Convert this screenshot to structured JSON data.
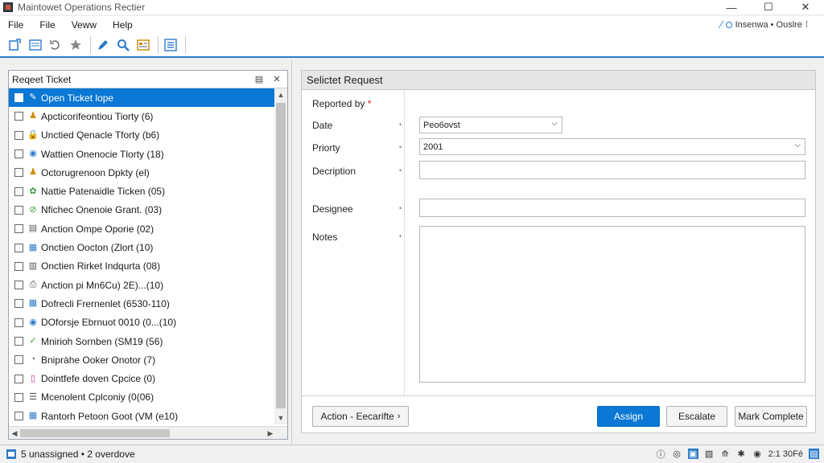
{
  "window": {
    "title": "Maintowet Operations Rectier",
    "minimize": "—",
    "maximize": "☐",
    "close": "✕"
  },
  "menu": {
    "items": [
      "File",
      "File",
      "Veww",
      "Help"
    ],
    "status_text": "Insenwa • Ouslre"
  },
  "left_panel": {
    "title": "Reqeet Ticket",
    "rows": [
      {
        "label": "Open Ticket lope",
        "icon": "ticket-icon",
        "color": "#2e8b57",
        "selected": true
      },
      {
        "label": "Apcticorifeontiou Tiorty (6)",
        "icon": "person-icon",
        "color": "#d08a00",
        "selected": false
      },
      {
        "label": "Unctied Qenacle Tforty (b6)",
        "icon": "lock-icon",
        "color": "#d08a00",
        "selected": false
      },
      {
        "label": "Wattien Onenocie Tlorty (18)",
        "icon": "circle-icon",
        "color": "#2c7bc9",
        "selected": false
      },
      {
        "label": "Octorugrenoon Dpkty (el)",
        "icon": "person-icon",
        "color": "#d08a00",
        "selected": false
      },
      {
        "label": "Nattie Patenaidle Ticken (05)",
        "icon": "gear-icon",
        "color": "#3a9a3a",
        "selected": false
      },
      {
        "label": "Nfichec Onenoie Grant. (03)",
        "icon": "check-circle-icon",
        "color": "#3a9a3a",
        "selected": false
      },
      {
        "label": "Anction Ompe Oporie (02)",
        "icon": "document-icon",
        "color": "#555555",
        "selected": false
      },
      {
        "label": "Onctien Oocton (Zlort (10)",
        "icon": "calendar-icon",
        "color": "#2c7bc9",
        "selected": false
      },
      {
        "label": "Onctien Rirket Indqurta (08)",
        "icon": "folder-icon",
        "color": "#555555",
        "selected": false
      },
      {
        "label": "Anction pi Mn6Cu) 2E)...(10)",
        "icon": "printer-icon",
        "color": "#555555",
        "selected": false
      },
      {
        "label": "Dofrecli Frernenlet (6530-110)",
        "icon": "calendar-icon",
        "color": "#2c7bc9",
        "selected": false
      },
      {
        "label": "DOforsje Ebrnuot 0010 (0...(10)",
        "icon": "circle-icon",
        "color": "#2c7bc9",
        "selected": false
      },
      {
        "label": "Mnirioh Sornben (SM19 (56)",
        "icon": "pencil-icon",
        "color": "#3a9a3a",
        "selected": false
      },
      {
        "label": "Bnipràhe Ooker Onotor (7)",
        "icon": "clock-icon",
        "color": "#555555",
        "selected": false
      },
      {
        "label": "Dointfefe doven Cpcice (0)",
        "icon": "tag-icon",
        "color": "#c0308a",
        "selected": false
      },
      {
        "label": "Mcenolent Cplconiy (0(06)",
        "icon": "list-icon",
        "color": "#555555",
        "selected": false
      },
      {
        "label": "Rantorh Petoon Goot (VM (e10)",
        "icon": "calendar-icon",
        "color": "#2c7bc9",
        "selected": false
      }
    ]
  },
  "right_panel": {
    "title": "Selictet Request",
    "labels": {
      "reported_by": "Reported by",
      "required_mark": "*",
      "date": "Date",
      "priority": "Priorty",
      "description": "Decription",
      "designee": "Designee",
      "notes": "Notes"
    },
    "fields": {
      "date_value": "Peo6ovst",
      "priority_value": "2001",
      "description_value": "",
      "designee_value": "",
      "notes_value": ""
    },
    "buttons": {
      "action": "Action - Eecarifte",
      "assign": "Assign",
      "escalate": "Escalate",
      "mark_complete": "Mark Complete"
    }
  },
  "statusbar": {
    "text": "5 unassigned • 2 overdove",
    "time": "2:1 30Fé"
  },
  "colors": {
    "accent": "#0a78d4",
    "toolbar_border": "#2c7bc9"
  }
}
